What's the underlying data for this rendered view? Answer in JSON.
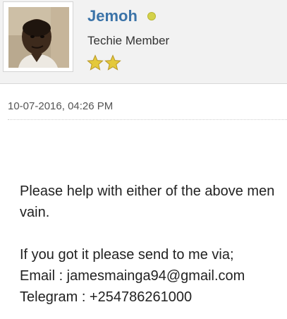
{
  "author": {
    "name": "Jemoh",
    "status_icon": "online-status-dot",
    "title": "Techie Member",
    "rank_stars": 2,
    "colors": {
      "name": "#3b73a8",
      "status_dot": "#d4d24a",
      "star": "#e4c93b"
    }
  },
  "post": {
    "date": "10-07-2016, 04:26 PM",
    "body_lines": [
      "Please help with either of the above men",
      "vain.",
      "If you got it please send to me via;",
      "Email : jamesmainga94@gmail.com",
      "Telegram : +254786261000"
    ]
  }
}
